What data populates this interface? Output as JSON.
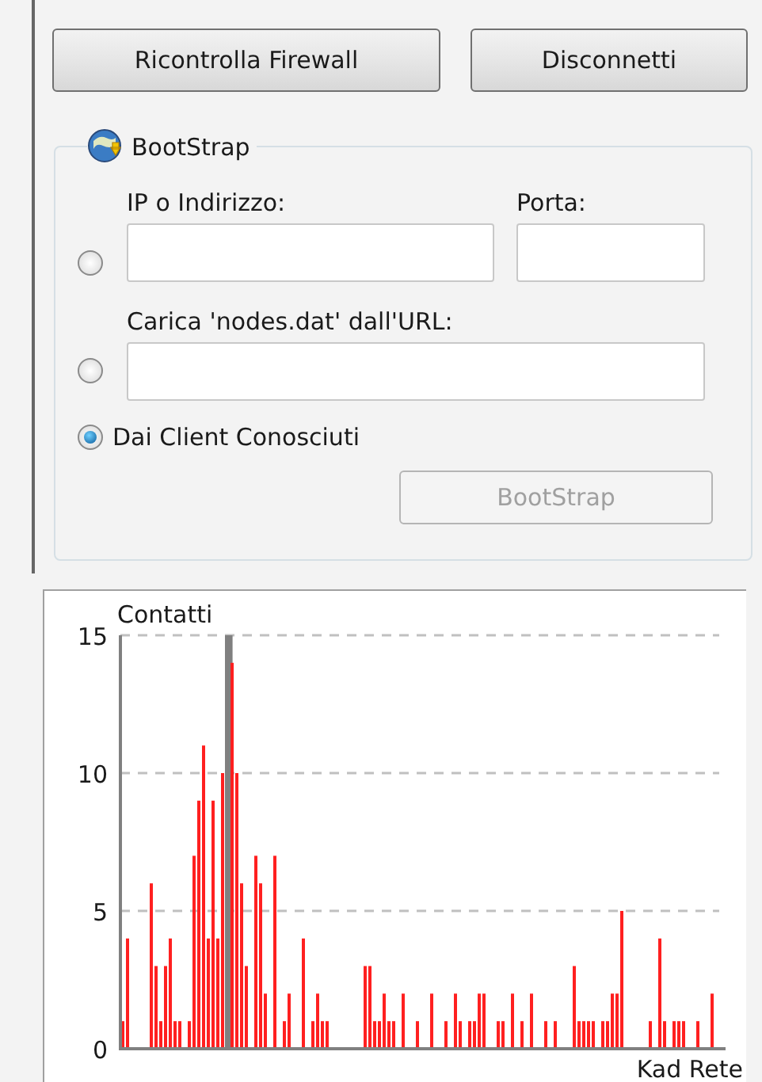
{
  "top_buttons": [
    {
      "label": "Ricontrolla Firewall"
    },
    {
      "label": "Disconnetti"
    }
  ],
  "bootstrap": {
    "title": "BootStrap",
    "options": [
      {
        "kind": "address",
        "selected": false,
        "ip_label": "IP o Indirizzo:",
        "port_label": "Porta:"
      },
      {
        "kind": "url",
        "selected": false,
        "label": "Carica 'nodes.dat' dall'URL:"
      },
      {
        "kind": "plain",
        "selected": true,
        "label": "Dai Client Conosciuti"
      }
    ],
    "button": {
      "label": "BootStrap",
      "disabled": true
    }
  },
  "graph": {
    "chart_data": {
      "type": "bar",
      "xlabel": "Kad Rete",
      "ylabel": "Contatti",
      "ylim": [
        0,
        15
      ],
      "yticks": [
        0,
        5,
        10,
        15
      ],
      "series": [
        {
          "color": "#ff2020",
          "values": [
            1,
            4,
            0,
            0,
            0,
            0,
            6,
            3,
            1,
            3,
            4,
            1,
            1,
            0,
            1,
            7,
            9,
            11,
            4,
            9,
            4,
            10,
            0,
            14,
            10,
            6,
            3,
            0,
            7,
            6,
            2,
            0,
            7,
            0,
            1,
            2,
            0,
            0,
            4,
            0,
            1,
            2,
            1,
            1,
            0,
            0,
            0,
            0,
            0,
            0,
            0,
            3,
            3,
            1,
            1,
            2,
            1,
            1,
            0,
            2,
            0,
            0,
            1,
            0,
            0,
            2,
            0,
            0,
            1,
            0,
            2,
            1,
            0,
            1,
            1,
            2,
            2,
            0,
            0,
            1,
            1,
            0,
            2,
            0,
            1,
            0,
            2,
            0,
            0,
            1,
            0,
            1,
            0,
            0,
            0,
            3,
            1,
            1,
            1,
            1,
            0,
            1,
            1,
            2,
            2,
            5,
            0,
            0,
            0,
            0,
            0,
            1,
            0,
            4,
            1,
            0,
            1,
            1,
            1,
            0,
            0,
            1,
            0,
            0,
            2,
            0
          ]
        },
        {
          "color": "#808080",
          "values": [
            null,
            null,
            null,
            null,
            null,
            null,
            null,
            null,
            null,
            null,
            null,
            null,
            null,
            null,
            null,
            null,
            null,
            null,
            null,
            null,
            null,
            null,
            15
          ]
        }
      ]
    }
  }
}
